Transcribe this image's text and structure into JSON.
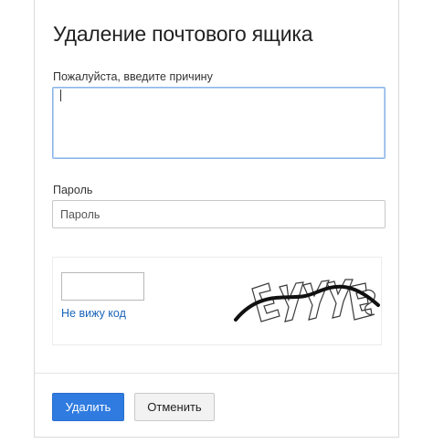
{
  "dialog": {
    "title": "Удаление почтового ящика",
    "reason": {
      "label": "Пожалуйста, введите причину",
      "value": ""
    },
    "password": {
      "label": "Пароль",
      "placeholder": "Пароль",
      "value": ""
    },
    "captcha": {
      "input_value": "",
      "link_text": "Не вижу код",
      "image_text": "E4YYE8"
    },
    "buttons": {
      "delete_label": "Удалить",
      "cancel_label": "Отменить"
    }
  },
  "colors": {
    "primary_button": "#2f7be0",
    "link": "#1a64b8",
    "focus_border": "#8ab4e8"
  }
}
